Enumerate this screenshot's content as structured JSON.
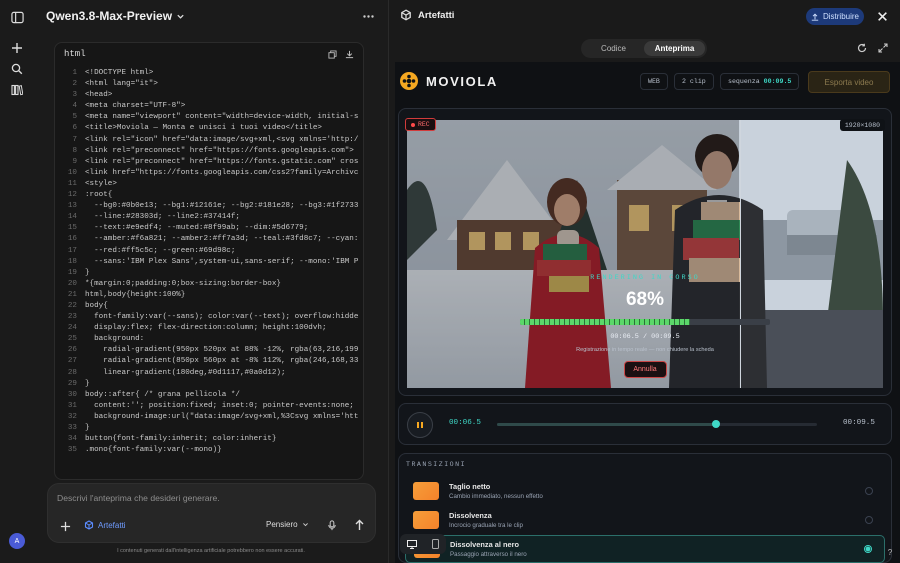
{
  "chat": {
    "title": "Qwen3.8-Max-Preview",
    "code_lang": "html",
    "lines": [
      "<!DOCTYPE html>",
      "<html lang=\"it\">",
      "<head>",
      "<meta charset=\"UTF-8\">",
      "<meta name=\"viewport\" content=\"width=device-width, initial-s",
      "<title>Moviola — Monta e unisci i tuoi video</title>",
      "<link rel=\"icon\" href=\"data:image/svg+xml,<svg xmlns='http:/",
      "<link rel=\"preconnect\" href=\"https://fonts.googleapis.com\">",
      "<link rel=\"preconnect\" href=\"https://fonts.gstatic.com\" cros",
      "<link href=\"https://fonts.googleapis.com/css2?family=Archivc",
      "<style>",
      ":root{",
      "  --bg0:#0b0e13; --bg1:#12161e; --bg2:#181e28; --bg3:#1f2733",
      "  --line:#28303d; --line2:#37414f;",
      "  --text:#e9edf4; --muted:#8f99ab; --dim:#5d6779;",
      "  --amber:#f6a821; --amber2:#ff7a3d; --teal:#3fd8c7; --cyan:",
      "  --red:#ff5c5c; --green:#69d98c;",
      "  --sans:'IBM Plex Sans',system-ui,sans-serif; --mono:'IBM P",
      "}",
      "*{margin:0;padding:0;box-sizing:border-box}",
      "html,body{height:100%}",
      "body{",
      "  font-family:var(--sans); color:var(--text); overflow:hidde",
      "  display:flex; flex-direction:column; height:100dvh;",
      "  background:",
      "    radial-gradient(950px 520px at 88% -12%, rgba(63,216,199",
      "    radial-gradient(850px 560px at -8% 112%, rgba(246,168,33",
      "    linear-gradient(180deg,#0d1117,#0a0d12);",
      "}",
      "body::after{ /* grana pellicola */",
      "  content:''; position:fixed; inset:0; pointer-events:none;",
      "  background-image:url(\"data:image/svg+xml,%3Csvg xmlns='htt",
      "}",
      "button{font-family:inherit; color:inherit}",
      ".mono{font-family:var(--mono)}"
    ],
    "prompt_placeholder": "Descrivi l'anteprima che desideri generare.",
    "artifacts_label": "Artefatti",
    "mode_label": "Pensiero",
    "footer": "I contenuti generati dall'intelligenza artificiale potrebbero non essere accurati.",
    "avatar_letter": "A"
  },
  "artifacts": {
    "title": "Artefatti",
    "share_label": "Distribuire",
    "tabs": [
      "Codice",
      "Anteprima"
    ],
    "active_tab": "Anteprima"
  },
  "app": {
    "brand": "MOVIOLA",
    "chips": [
      "WEB",
      "2 clip"
    ],
    "sequence_label": "sequenza",
    "sequence_time": "00:09.5",
    "export_label": "Esporta video",
    "rec_label": "REC",
    "resolution": "1920×1080",
    "render_label": "RENDERING IN CORSO",
    "progress_text": "68%",
    "progress_value": 0.68,
    "render_time": "00:06.5 / 00:09.5",
    "render_note": "Registrazione in tempo reale — non chiudere la scheda",
    "cancel_label": "Annulla",
    "current_time": "00:06.5",
    "total_time": "00:09.5",
    "transitions_heading": "TRANSIZIONI",
    "transitions": [
      {
        "name": "Taglio netto",
        "desc": "Cambio immediato, nessun effetto"
      },
      {
        "name": "Dissolvenza",
        "desc": "Incrocio graduale tra le clip"
      },
      {
        "name": "Dissolvenza al nero",
        "desc": "Passaggio attraverso il nero"
      }
    ],
    "selected_transition": "Dissolvenza al nero"
  },
  "colors": {
    "accent": "#3fd8c7",
    "amber": "#f6a821",
    "share_blue": "#1d3a7a"
  }
}
